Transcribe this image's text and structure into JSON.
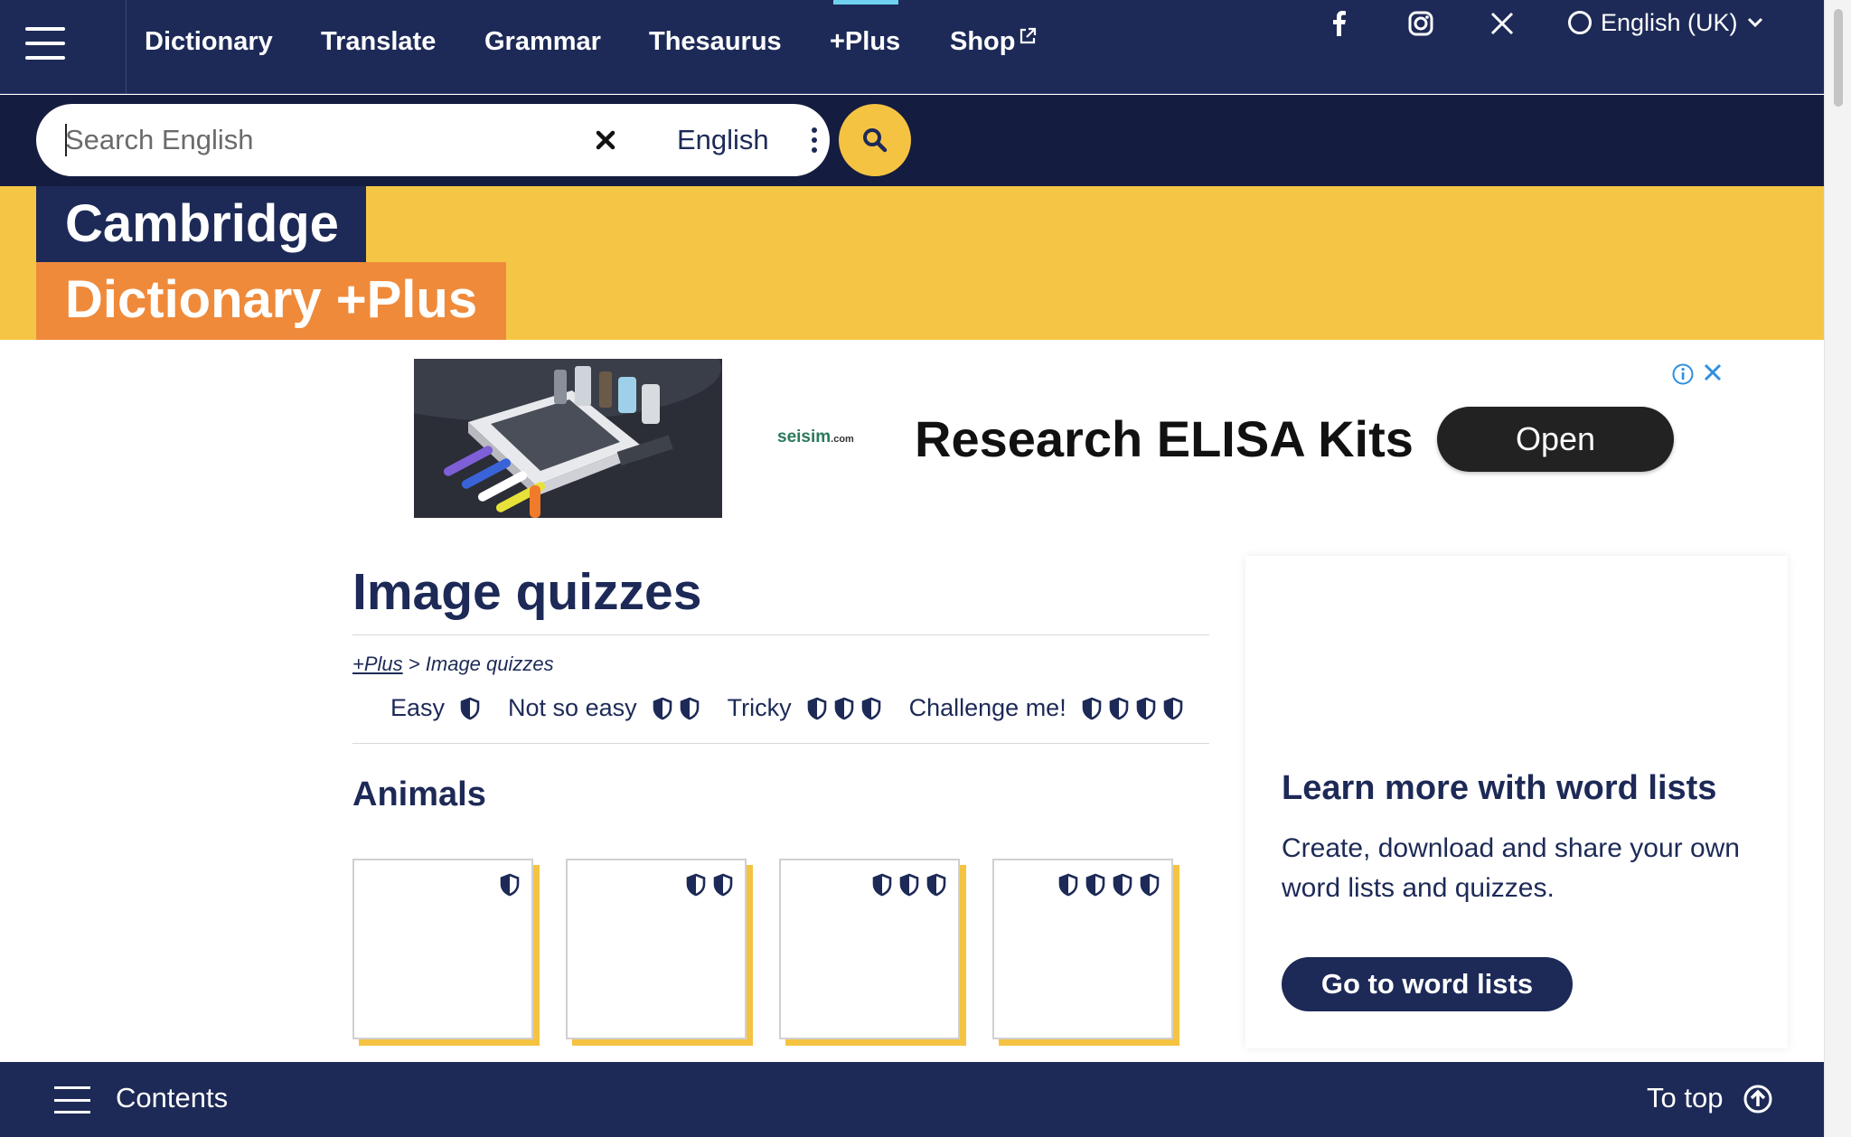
{
  "nav": {
    "menu_icon": "hamburger-menu-icon",
    "links": [
      {
        "label": "Dictionary"
      },
      {
        "label": "Translate"
      },
      {
        "label": "Grammar"
      },
      {
        "label": "Thesaurus"
      },
      {
        "label": "+Plus"
      },
      {
        "label": "Shop"
      }
    ],
    "shop_icon": "external-link-icon",
    "social_icons": [
      "facebook-icon",
      "instagram-icon",
      "x-twitter-icon"
    ],
    "language_label": "English (UK)",
    "language_icon": "globe-icon"
  },
  "search": {
    "placeholder": "Search English",
    "value": "",
    "dictionary": "English",
    "clear_icon": "close-icon",
    "submit_icon": "search-icon"
  },
  "hero": {
    "brand_line1": "Cambridge",
    "brand_line2": "Dictionary +Plus"
  },
  "ad": {
    "advertiser": "seisim",
    "advertiser_suffix": ".com",
    "headline": "Research ELISA Kits",
    "cta": "Open"
  },
  "main": {
    "title": "Image quizzes",
    "breadcrumb": {
      "link": "+Plus",
      "separator": ">",
      "current": "Image quizzes"
    },
    "difficulty_legend": [
      {
        "label": "Easy",
        "level": 1
      },
      {
        "label": "Not so easy",
        "level": 2
      },
      {
        "label": "Tricky",
        "level": 3
      },
      {
        "label": "Challenge me!",
        "level": 4
      }
    ],
    "section": {
      "title": "Animals",
      "cards": [
        {
          "level": 1
        },
        {
          "level": 2
        },
        {
          "level": 3
        },
        {
          "level": 4
        }
      ]
    }
  },
  "sidebar": {
    "heading": "Learn more with word lists",
    "text": "Create, download and share your own word lists and quizzes.",
    "button": "Go to word lists"
  },
  "footer": {
    "contents_label": "Contents",
    "to_top_label": "To top"
  },
  "colors": {
    "navy": "#1d2a57",
    "yellow": "#f5c646",
    "orange": "#ef8a3b",
    "accent_cyan": "#6fd0ef"
  }
}
